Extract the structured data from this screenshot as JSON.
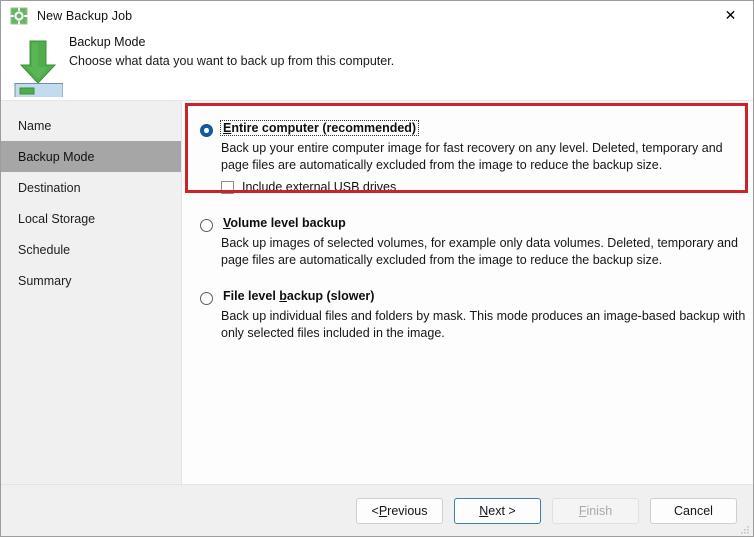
{
  "window": {
    "title": "New Backup Job",
    "app_icon": "gear-icon",
    "close_label": "✕"
  },
  "header": {
    "icon": "download-arrow-disk-icon",
    "title": "Backup Mode",
    "subtitle": "Choose what data you want to back up from this computer."
  },
  "sidebar": {
    "items": [
      {
        "label": "Name",
        "active": false
      },
      {
        "label": "Backup Mode",
        "active": true
      },
      {
        "label": "Destination",
        "active": false
      },
      {
        "label": "Local Storage",
        "active": false
      },
      {
        "label": "Schedule",
        "active": false
      },
      {
        "label": "Summary",
        "active": false
      }
    ]
  },
  "main": {
    "options": [
      {
        "label_pre": "",
        "label_accel": "E",
        "label_post": "ntire computer (recommended)",
        "label_full": "Entire computer (recommended)",
        "description": "Back up your entire computer image for fast recovery on any level. Deleted, temporary and page files are automatically excluded from the image to reduce the backup size.",
        "selected": true,
        "focused": true,
        "checkbox": {
          "label_pre": "Include external ",
          "label_accel": "U",
          "label_post": "SB drives",
          "label_full": "Include external USB drives",
          "checked": false
        }
      },
      {
        "label_pre": "",
        "label_accel": "V",
        "label_post": "olume level backup",
        "label_full": "Volume level backup",
        "description": "Back up images of selected volumes, for example only data volumes. Deleted, temporary and page files are automatically excluded from the image to reduce the backup size.",
        "selected": false,
        "focused": false,
        "checkbox": null
      },
      {
        "label_pre": "File level ",
        "label_accel": "b",
        "label_post": "ackup (slower)",
        "label_full": "File level backup (slower)",
        "description": "Back up individual files and folders by mask. This mode produces an image-based backup with only selected files included in the image.",
        "selected": false,
        "focused": false,
        "checkbox": null
      }
    ]
  },
  "footer": {
    "buttons": [
      {
        "name": "previous",
        "pre": "< ",
        "accel": "P",
        "post": "revious",
        "full": "< Previous",
        "state": "normal"
      },
      {
        "name": "next",
        "pre": "",
        "accel": "N",
        "post": "ext >",
        "full": "Next >",
        "state": "default"
      },
      {
        "name": "finish",
        "pre": "",
        "accel": "F",
        "post": "inish",
        "full": "Finish",
        "state": "disabled"
      },
      {
        "name": "cancel",
        "pre": "Cancel",
        "accel": "",
        "post": "",
        "full": "Cancel",
        "state": "normal"
      }
    ]
  },
  "annotation": {
    "highlight_color": "#cc2229",
    "highlight_target": "Entire computer (recommended) option group"
  }
}
